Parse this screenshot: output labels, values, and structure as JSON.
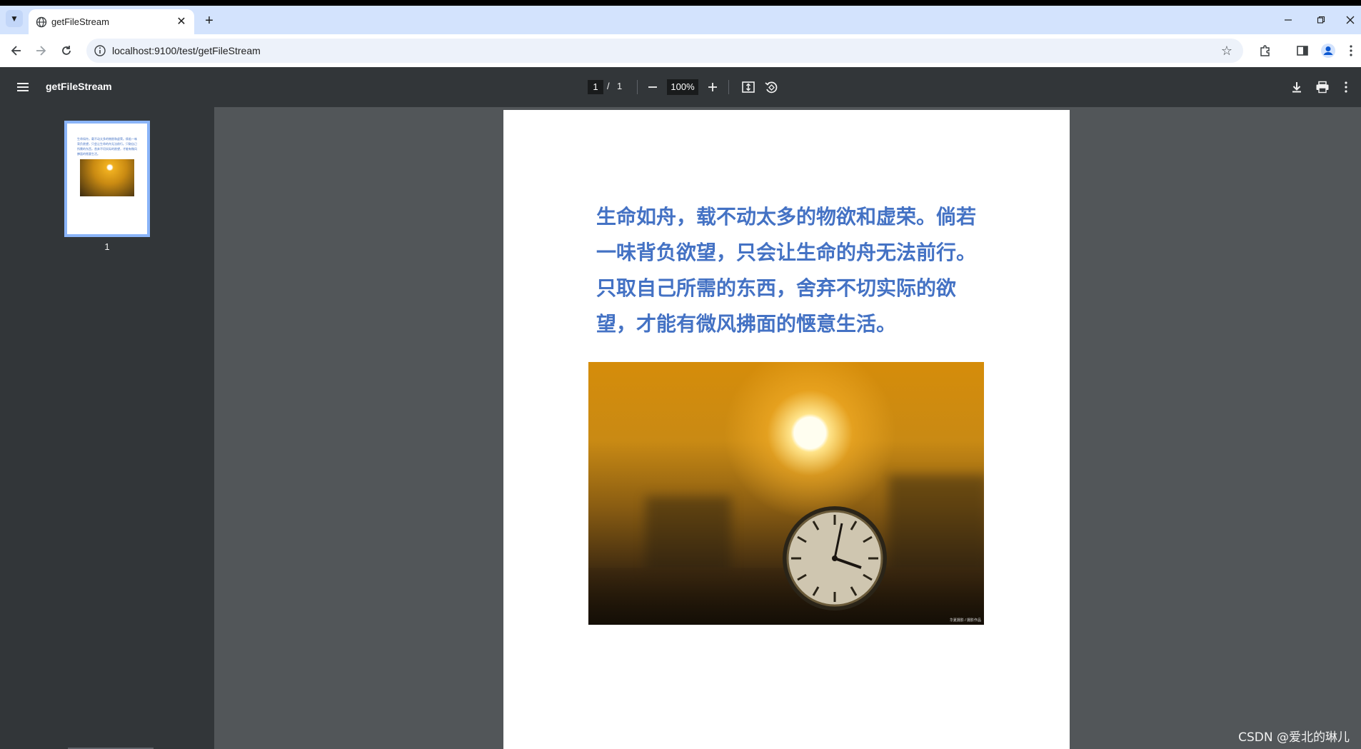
{
  "browser": {
    "tab_title": "getFileStream",
    "url": "localhost:9100/test/getFileStream",
    "new_tab_symbol": "+",
    "close_symbol": "✕"
  },
  "viewer": {
    "title": "getFileStream",
    "current_page": "1",
    "page_separator": "/",
    "total_pages": "1",
    "zoom": "100%",
    "thumbnail_label": "1"
  },
  "document": {
    "text": "生命如舟，载不动太多的物欲和虚荣。倘若一味背负欲望，只会让生命的舟无法前行。只取自己所需的东西，舍弃不切实际的欲望，才能有微风拂面的惬意生活。",
    "photo_caption": "华夏摄影 / 摄影作品"
  },
  "watermark": "CSDN @爱北的琳儿",
  "colors": {
    "tab_strip": "#d3e3fd",
    "pdf_toolbar": "#323639",
    "viewer_background": "#525659",
    "document_text": "#4472c4",
    "thumbnail_border": "#8ab4f8"
  }
}
